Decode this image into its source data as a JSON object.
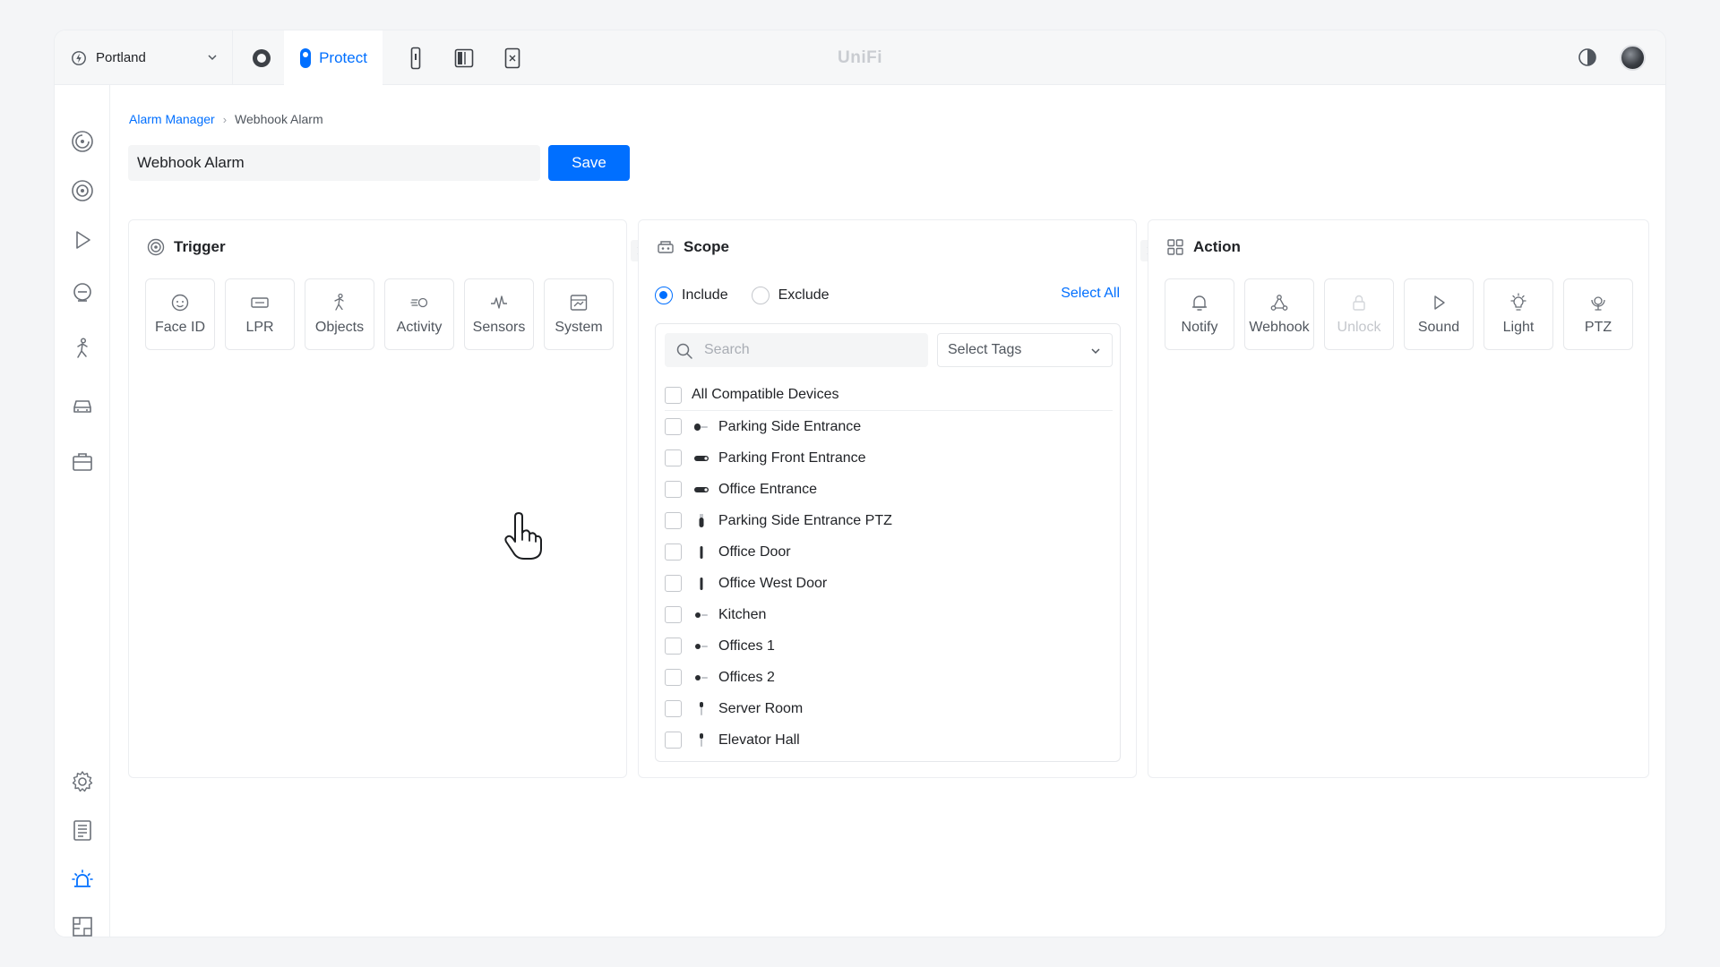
{
  "topbar": {
    "site_name": "Portland",
    "active_app_label": "Protect",
    "brand": "UniFi"
  },
  "breadcrumb": {
    "parent": "Alarm Manager",
    "current": "Webhook Alarm"
  },
  "editor": {
    "name_value": "Webhook Alarm",
    "save_label": "Save"
  },
  "trigger": {
    "title": "Trigger",
    "tiles": [
      {
        "label": "Face ID",
        "icon": "face-icon"
      },
      {
        "label": "LPR",
        "icon": "license-plate-icon"
      },
      {
        "label": "Objects",
        "icon": "person-icon"
      },
      {
        "label": "Activity",
        "icon": "motion-icon"
      },
      {
        "label": "Sensors",
        "icon": "pulse-icon"
      },
      {
        "label": "System",
        "icon": "system-icon"
      }
    ]
  },
  "scope": {
    "title": "Scope",
    "include_label": "Include",
    "exclude_label": "Exclude",
    "mode": "include",
    "select_all_label": "Select All",
    "search_placeholder": "Search",
    "tags_placeholder": "Select Tags",
    "all_label": "All Compatible Devices",
    "devices": [
      {
        "name": "Parking Side Entrance",
        "icon": "bullet-camera-icon"
      },
      {
        "name": "Parking Front Entrance",
        "icon": "bullet-camera-icon"
      },
      {
        "name": "Office Entrance",
        "icon": "bullet-camera-icon"
      },
      {
        "name": "Parking Side Entrance PTZ",
        "icon": "ptz-camera-icon"
      },
      {
        "name": "Office Door",
        "icon": "doorbell-icon"
      },
      {
        "name": "Office West Door",
        "icon": "doorbell-icon"
      },
      {
        "name": "Kitchen",
        "icon": "dome-camera-icon"
      },
      {
        "name": "Offices 1",
        "icon": "dome-camera-icon"
      },
      {
        "name": "Offices 2",
        "icon": "dome-camera-icon"
      },
      {
        "name": "Server Room",
        "icon": "sensor-icon"
      },
      {
        "name": "Elevator Hall",
        "icon": "sensor-icon"
      }
    ]
  },
  "action": {
    "title": "Action",
    "tiles": [
      {
        "label": "Notify",
        "icon": "bell-icon",
        "enabled": true
      },
      {
        "label": "Webhook",
        "icon": "webhook-icon",
        "enabled": true
      },
      {
        "label": "Unlock",
        "icon": "lock-icon",
        "enabled": false
      },
      {
        "label": "Sound",
        "icon": "play-icon",
        "enabled": true
      },
      {
        "label": "Light",
        "icon": "bulb-icon",
        "enabled": true
      },
      {
        "label": "PTZ",
        "icon": "ptz-icon",
        "enabled": true
      }
    ]
  },
  "colors": {
    "accent": "#006fff",
    "text": "#212327",
    "muted": "#50565e",
    "border": "#e6e8eb"
  }
}
